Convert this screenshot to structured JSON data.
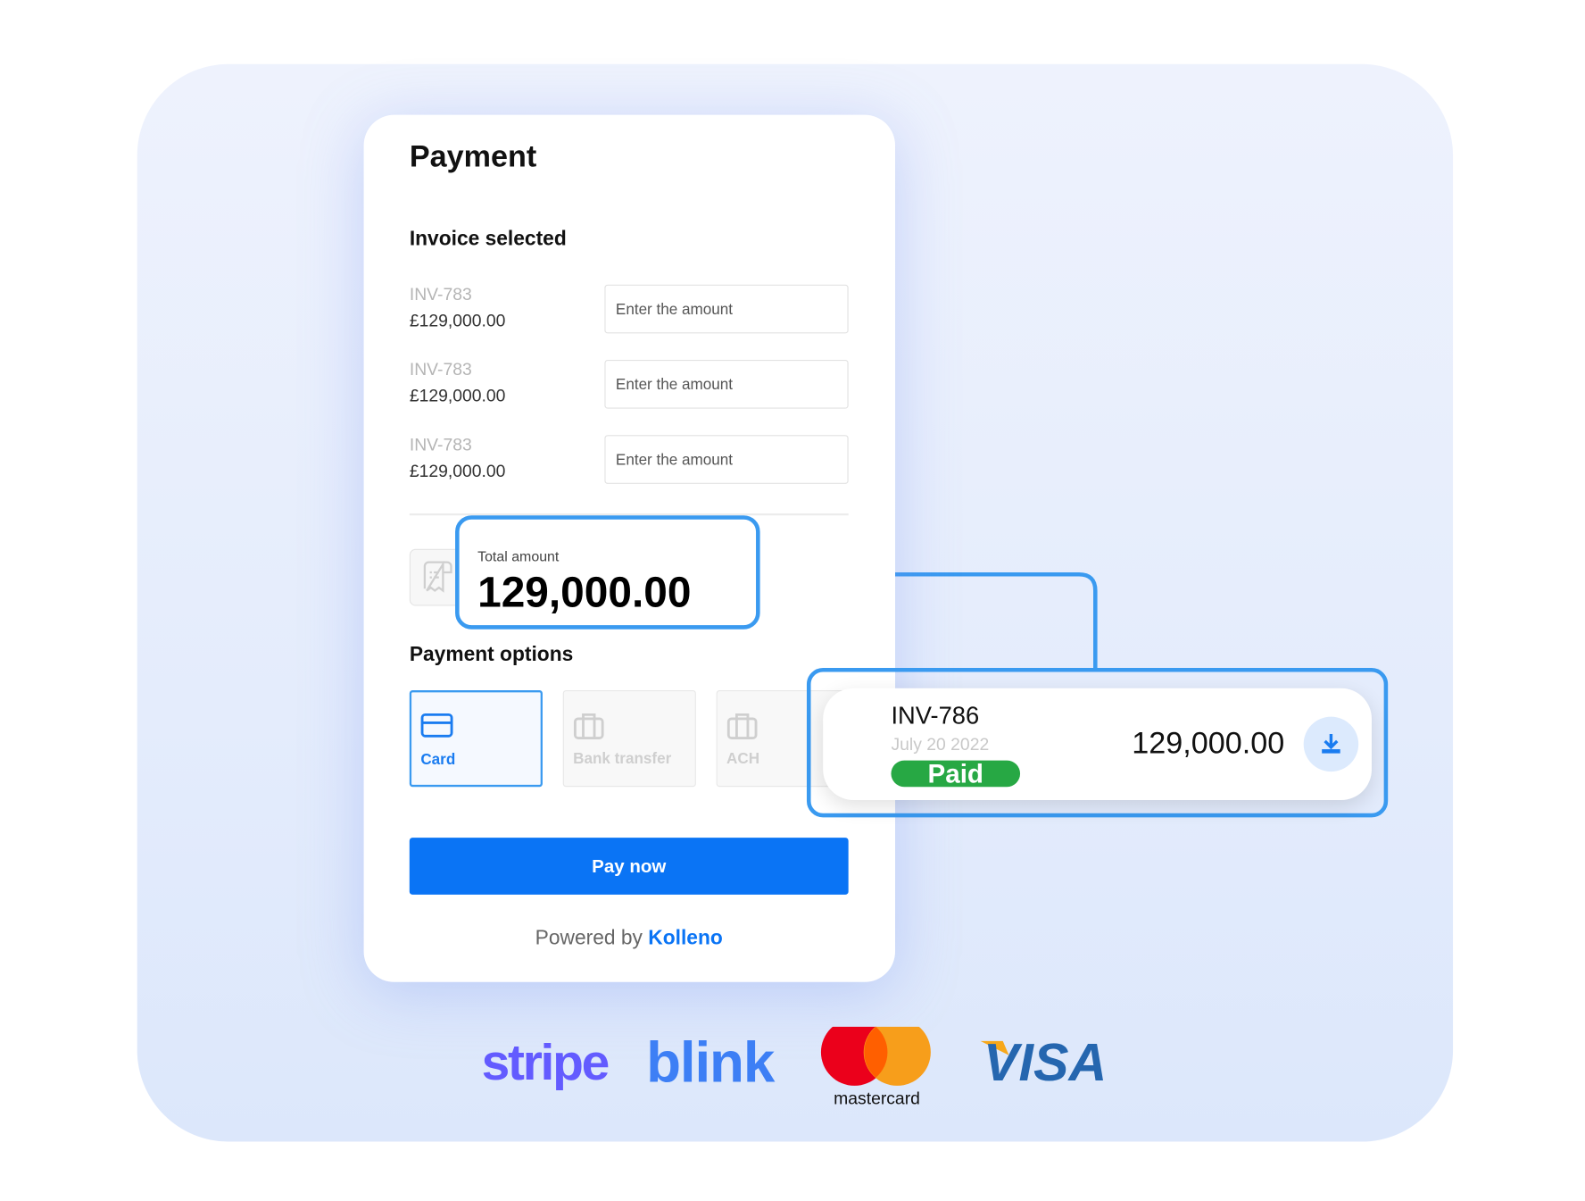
{
  "payment": {
    "title": "Payment",
    "invoice_section": "Invoice selected",
    "invoices": [
      {
        "id": "INV-783",
        "amount": "£129,000.00",
        "placeholder": "Enter the amount"
      },
      {
        "id": "INV-783",
        "amount": "£129,000.00",
        "placeholder": "Enter the amount"
      },
      {
        "id": "INV-783",
        "amount": "£129,000.00",
        "placeholder": "Enter the amount"
      }
    ],
    "total_label": "Total amount",
    "total_value": "129,000.00",
    "options_title": "Payment options",
    "options": [
      {
        "label": "Card",
        "icon": "credit-card-icon",
        "selected": true
      },
      {
        "label": "Bank transfer",
        "icon": "briefcase-icon",
        "selected": false
      },
      {
        "label": "ACH",
        "icon": "briefcase-icon",
        "selected": false
      }
    ],
    "pay_button": "Pay now",
    "powered_prefix": "Powered by",
    "powered_brand": "Kolleno"
  },
  "invoice_card": {
    "id": "INV-786",
    "date": "July  20 2022",
    "status": "Paid",
    "amount": "129,000.00",
    "download_icon": "download-icon"
  },
  "logos": [
    "stripe",
    "blink",
    "mastercard",
    "VISA"
  ],
  "colors": {
    "accent": "#0a74f5",
    "highlight": "#3a9af0",
    "paid": "#27a844",
    "stripe": "#635bff",
    "blink": "#3d7ff5",
    "visa": "#2566af"
  }
}
